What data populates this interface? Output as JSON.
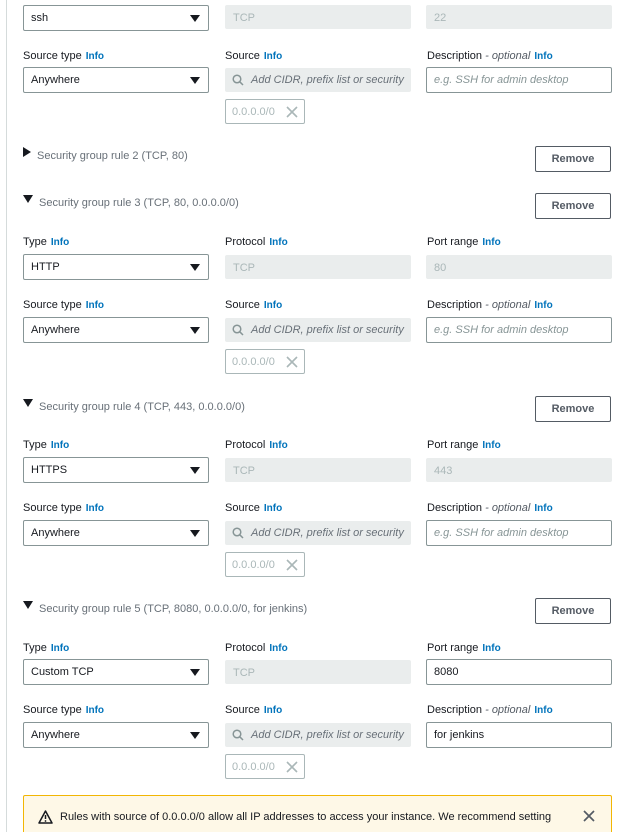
{
  "rule1": {
    "type_value": "ssh",
    "protocol_value": "TCP",
    "port_value": "22",
    "source_type_label": "Source type",
    "source_label": "Source",
    "description_label": "Description",
    "description_optional": "- optional",
    "source_type_value": "Anywhere",
    "source_placeholder": "Add CIDR, prefix list or security",
    "description_placeholder": "e.g. SSH for admin desktop",
    "token": "0.0.0.0/0"
  },
  "info": "Info",
  "remove": "Remove",
  "rule2": {
    "title": "Security group rule 2 (TCP, 80)"
  },
  "rule3": {
    "title": "Security group rule 3 (TCP, 80, 0.0.0.0/0)",
    "type_label": "Type",
    "protocol_label": "Protocol",
    "port_label": "Port range",
    "type_value": "HTTP",
    "protocol_value": "TCP",
    "port_value": "80",
    "source_type_label": "Source type",
    "source_label": "Source",
    "description_label": "Description",
    "description_optional": "- optional",
    "source_type_value": "Anywhere",
    "source_placeholder": "Add CIDR, prefix list or security",
    "description_placeholder": "e.g. SSH for admin desktop",
    "token": "0.0.0.0/0"
  },
  "rule4": {
    "title": "Security group rule 4 (TCP, 443, 0.0.0.0/0)",
    "type_label": "Type",
    "protocol_label": "Protocol",
    "port_label": "Port range",
    "type_value": "HTTPS",
    "protocol_value": "TCP",
    "port_value": "443",
    "source_type_label": "Source type",
    "source_label": "Source",
    "description_label": "Description",
    "description_optional": "- optional",
    "source_type_value": "Anywhere",
    "source_placeholder": "Add CIDR, prefix list or security",
    "description_placeholder": "e.g. SSH for admin desktop",
    "token": "0.0.0.0/0"
  },
  "rule5": {
    "title": "Security group rule 5 (TCP, 8080, 0.0.0.0/0, for jenkins)",
    "type_label": "Type",
    "protocol_label": "Protocol",
    "port_label": "Port range",
    "type_value": "Custom TCP",
    "protocol_value": "TCP",
    "port_value": "8080",
    "source_type_label": "Source type",
    "source_label": "Source",
    "description_label": "Description",
    "description_optional": "- optional",
    "source_type_value": "Anywhere",
    "source_placeholder": "Add CIDR, prefix list or security",
    "description_value": "for jenkins",
    "token": "0.0.0.0/0"
  },
  "alert": {
    "text": "Rules with source of 0.0.0.0/0 allow all IP addresses to access your instance. We recommend setting"
  },
  "icons": {
    "search": "search-icon",
    "close": "close-icon",
    "caret": "caret-down-icon",
    "warning": "warning-icon",
    "expand": "triangle-right-icon",
    "collapse": "triangle-down-icon"
  },
  "colors": {
    "info_link": "#0073bb",
    "disabled_bg": "#eaeded",
    "alert_bg": "#fef8e7",
    "alert_border": "#f2b604"
  }
}
